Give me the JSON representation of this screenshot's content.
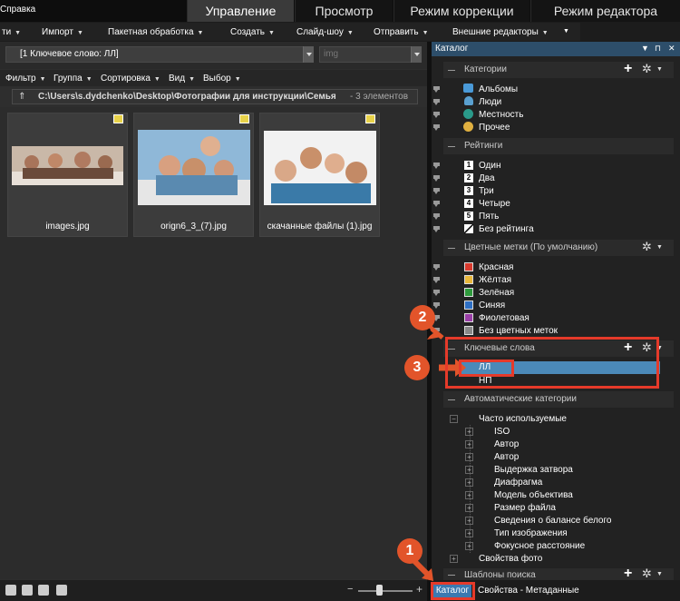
{
  "app_menu": {
    "help_label": "Справка"
  },
  "mode_tabs": [
    {
      "label": "Управление",
      "active": true
    },
    {
      "label": "Просмотр",
      "active": false
    },
    {
      "label": "Режим коррекции",
      "active": false
    },
    {
      "label": "Режим редактора",
      "active": false
    }
  ],
  "menu": [
    {
      "label": "ти"
    },
    {
      "label": "Импорт"
    },
    {
      "label": "Пакетная обработка"
    },
    {
      "label": "Создать"
    },
    {
      "label": "Слайд-шоу"
    },
    {
      "label": "Отправить"
    },
    {
      "label": "Внешние редакторы"
    }
  ],
  "toolbar": {
    "keyword_combo_value": "[1 Ключевое слово: ЛЛ]",
    "folder_combo_value": "img"
  },
  "filterbar": [
    {
      "label": "Фильтр"
    },
    {
      "label": "Группа"
    },
    {
      "label": "Сортировка"
    },
    {
      "label": "Вид"
    },
    {
      "label": "Выбор"
    }
  ],
  "path": {
    "text": "C:\\Users\\s.dydchenko\\Desktop\\Фотографии для инструкции\\Семья",
    "count": "- 3 элементов"
  },
  "thumbnails": [
    {
      "name": "images.jpg"
    },
    {
      "name": "orign6_3_(7).jpg"
    },
    {
      "name": "скачанные файлы (1).jpg"
    }
  ],
  "catalog": {
    "title": "Каталог",
    "sections": {
      "categories": "Категории",
      "ratings": "Рейтинги",
      "color_labels": "Цветные метки (По умолчанию)",
      "keywords": "Ключевые слова",
      "auto_categories": "Автоматические категории",
      "search_templates": "Шаблоны поиска"
    },
    "categories": [
      "Альбомы",
      "Люди",
      "Местность",
      "Прочее"
    ],
    "ratings": [
      {
        "n": "1",
        "label": "Один"
      },
      {
        "n": "2",
        "label": "Два"
      },
      {
        "n": "3",
        "label": "Три"
      },
      {
        "n": "4",
        "label": "Четыре"
      },
      {
        "n": "5",
        "label": "Пять"
      }
    ],
    "no_rating": "Без рейтинга",
    "colors": [
      {
        "label": "Красная",
        "color": "#d83a2e"
      },
      {
        "label": "Жёлтая",
        "color": "#e9b73a"
      },
      {
        "label": "Зелёная",
        "color": "#2e9a3c"
      },
      {
        "label": "Синяя",
        "color": "#2e6fc4"
      },
      {
        "label": "Фиолетовая",
        "color": "#9a3fa8"
      }
    ],
    "no_color": "Без цветных меток",
    "keywords": [
      "ЛЛ",
      "НП"
    ],
    "frequent": "Часто используемые",
    "auto_items": [
      "ISO",
      "Автор",
      "Автор",
      "Выдержка затвора",
      "Диафрагма",
      "Модель объектива",
      "Размер файла",
      "Сведения о балансе белого",
      "Тип изображения",
      "Фокусное расстояние"
    ],
    "photo_props": "Свойства фото"
  },
  "bottom_tabs": {
    "catalog": "Каталог",
    "metadata": "Свойства - Метаданные"
  },
  "callouts": [
    "1",
    "2",
    "3"
  ]
}
